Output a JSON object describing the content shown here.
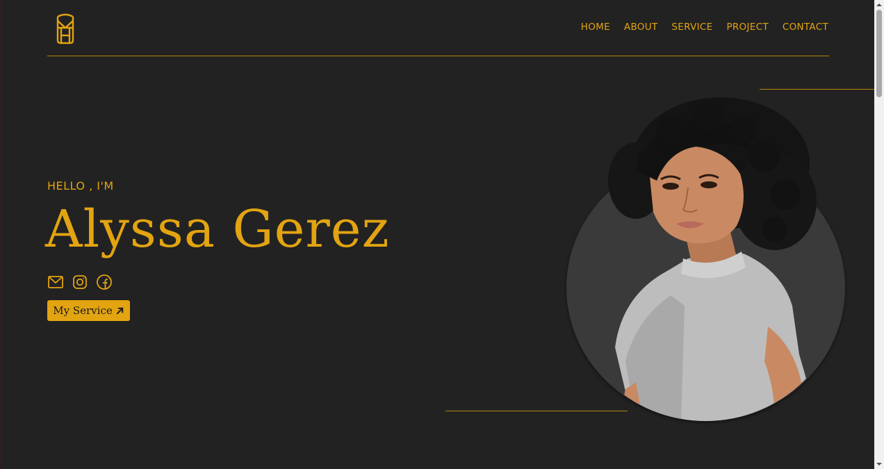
{
  "header": {
    "logo_icon": "monogram-logo-icon",
    "nav": [
      {
        "label": "HOME"
      },
      {
        "label": "ABOUT"
      },
      {
        "label": "SERVICE"
      },
      {
        "label": "PROJECT"
      },
      {
        "label": "CONTACT"
      }
    ]
  },
  "hero": {
    "greeting": "HELLO , I'M",
    "name": "Alyssa Gerez",
    "socials": [
      {
        "icon": "mail-icon"
      },
      {
        "icon": "instagram-icon"
      },
      {
        "icon": "facebook-icon"
      }
    ],
    "cta_label": "My Service",
    "cta_icon": "arrow-up-right-icon"
  },
  "colors": {
    "background": "#222222",
    "accent": "#e3a411",
    "circle": "#3a3a3a"
  }
}
